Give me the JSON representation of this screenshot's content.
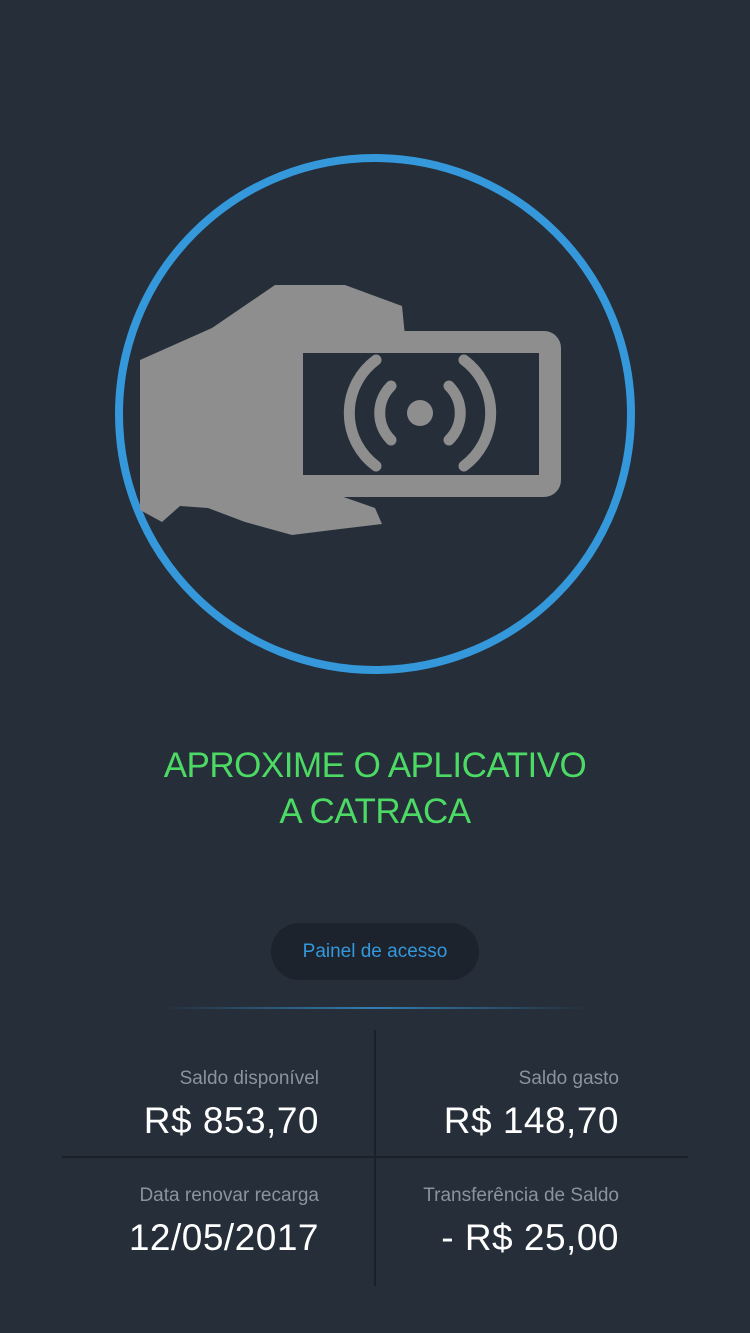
{
  "colors": {
    "background": "#252e39",
    "accent_blue": "#3498db",
    "accent_green": "#4cd964",
    "icon_gray": "#8e8e8e"
  },
  "hero": {
    "icon": "hand-holding-phone-nfc-icon",
    "instruction_line1": "APROXIME O APLICATIVO",
    "instruction_line2": "A CATRACA"
  },
  "panel_button": {
    "label": "Painel de acesso"
  },
  "stats": {
    "saldo_disponivel": {
      "label": "Saldo disponível",
      "value": "R$ 853,70"
    },
    "saldo_gasto": {
      "label": "Saldo gasto",
      "value": "R$ 148,70"
    },
    "data_renovar": {
      "label": "Data renovar recarga",
      "value": "12/05/2017"
    },
    "transferencia": {
      "label": "Transferência de Saldo",
      "value": "- R$ 25,00"
    }
  }
}
